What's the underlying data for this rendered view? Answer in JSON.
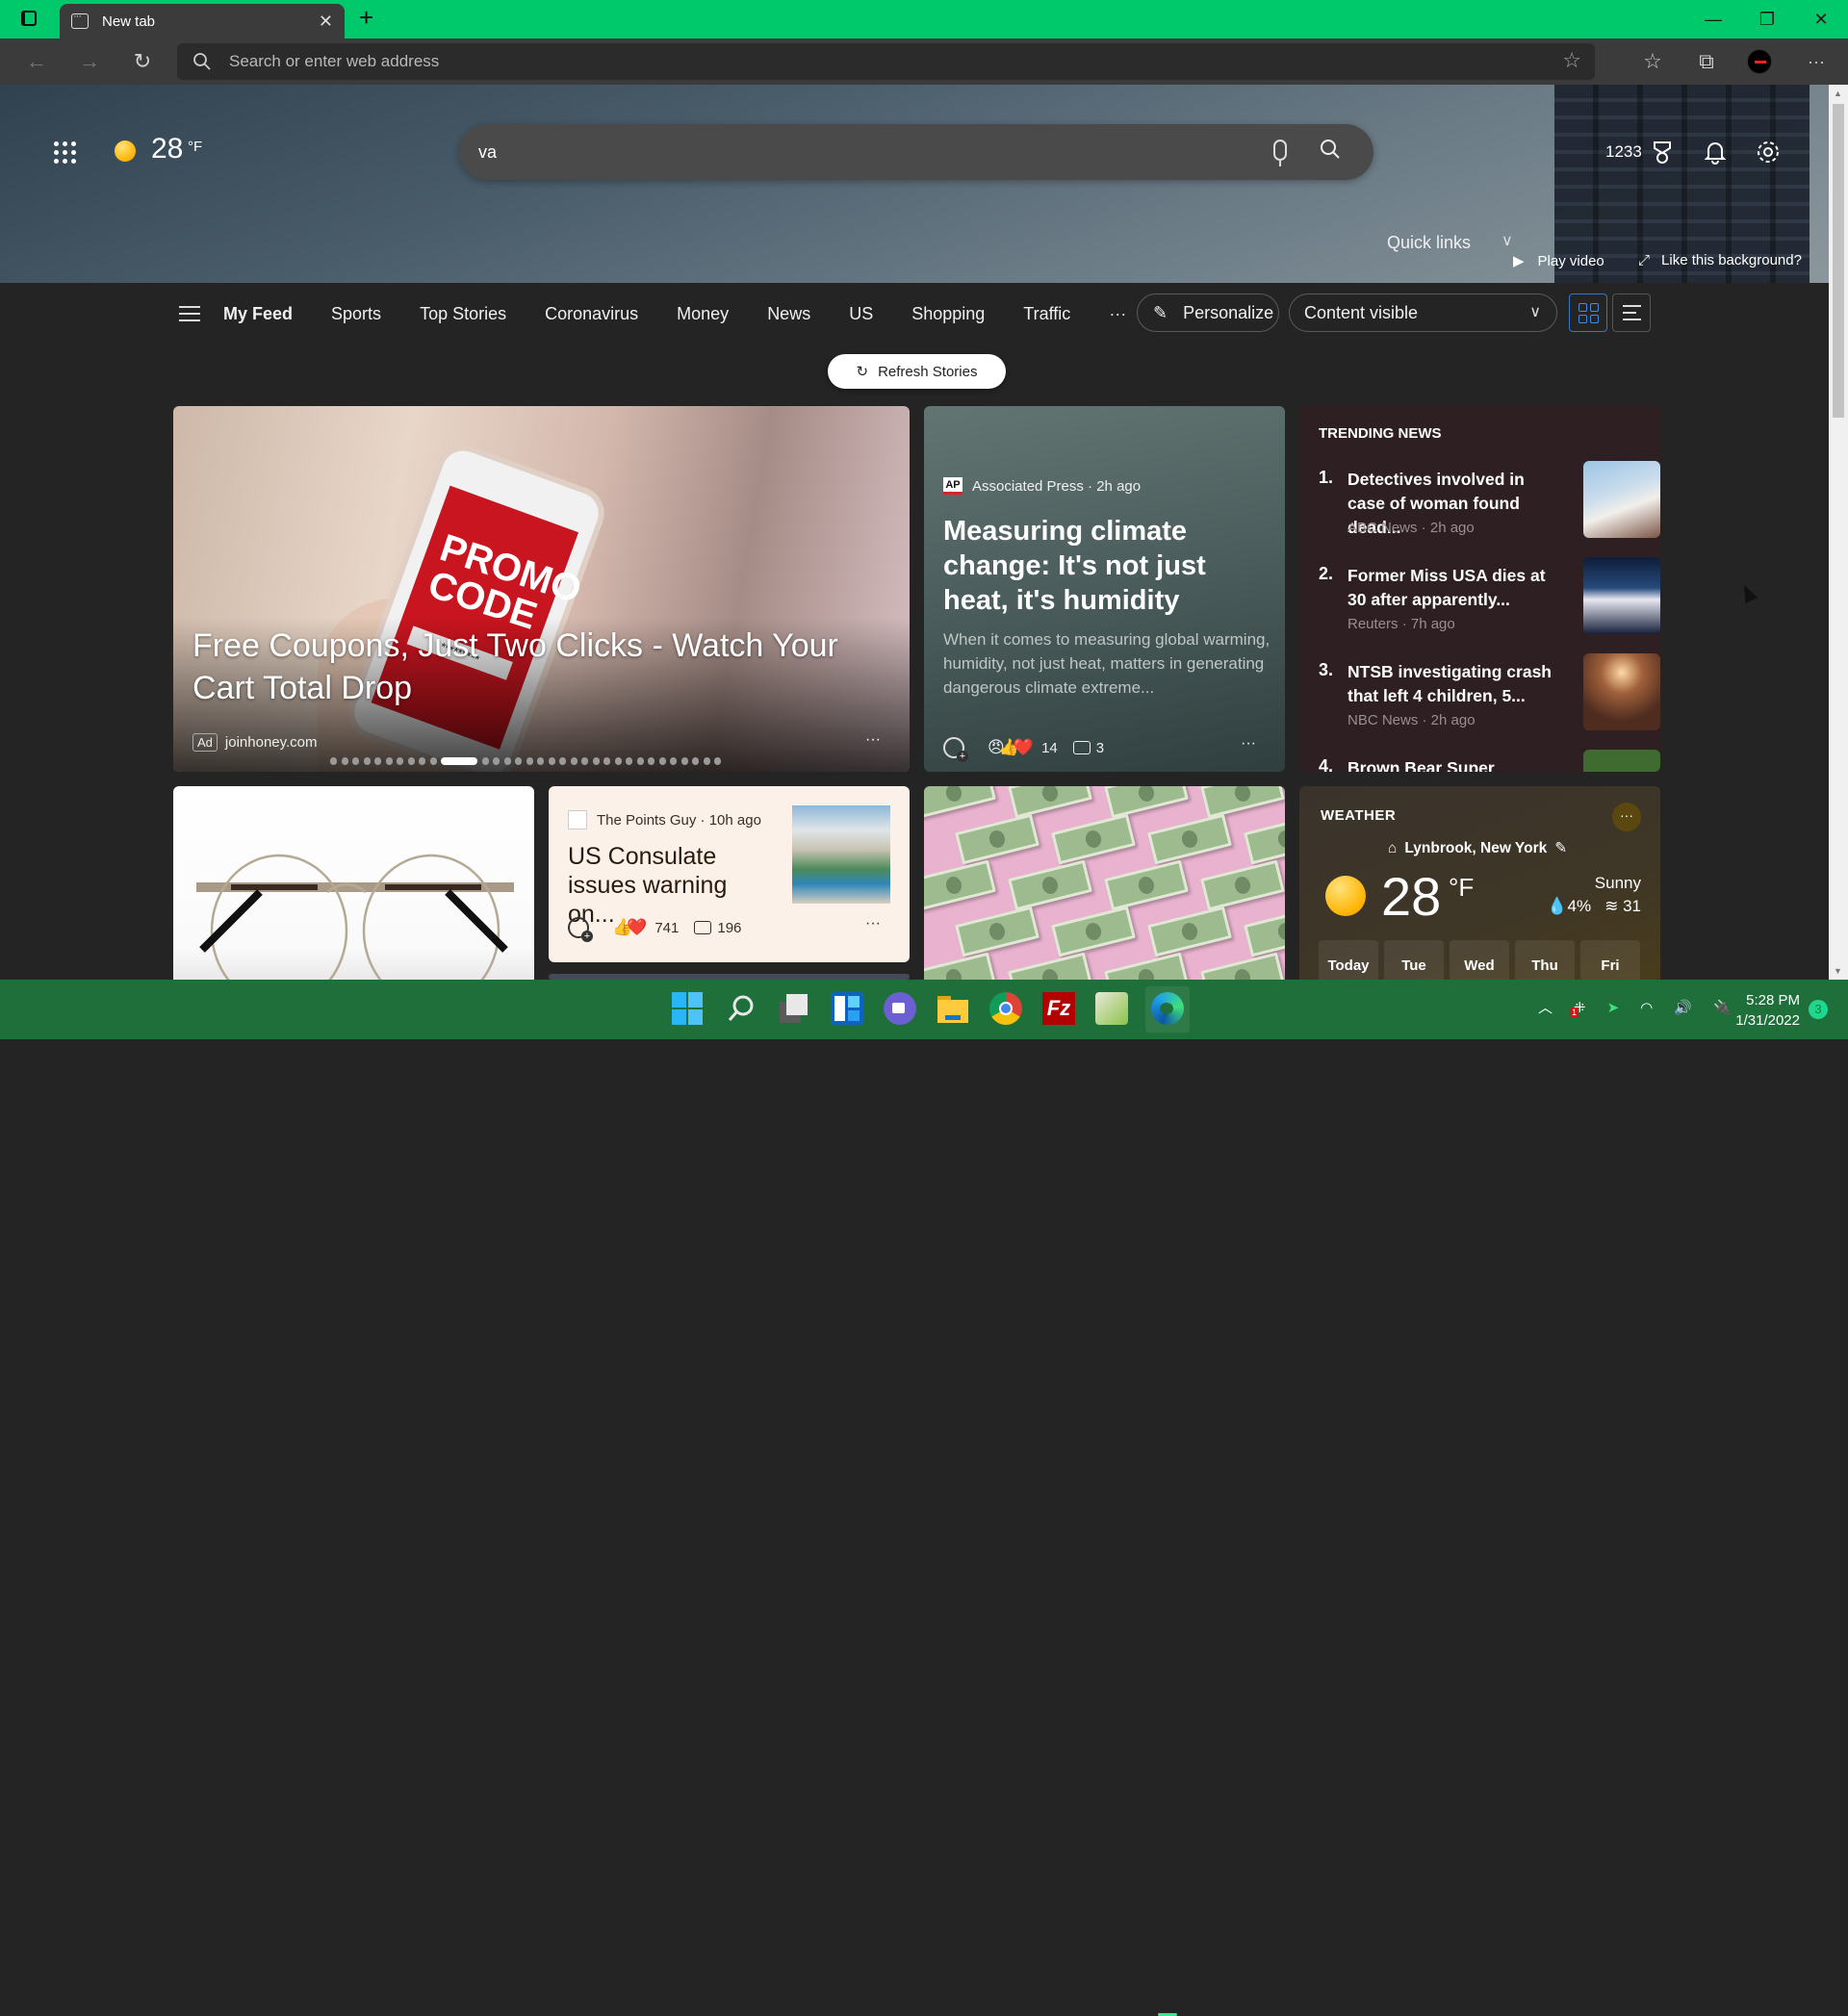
{
  "browser": {
    "tab_title": "New tab",
    "address_placeholder": "Search or enter web address",
    "accent_color": "#00c96b"
  },
  "banner": {
    "temperature": "28",
    "temperature_unit": "°F",
    "search_value": "va",
    "rewards_points": "1233",
    "quick_links_label": "Quick links",
    "play_video_label": "Play video",
    "like_background_label": "Like this background?"
  },
  "nav": {
    "items": [
      {
        "label": "My Feed",
        "active": true
      },
      {
        "label": "Sports"
      },
      {
        "label": "Top Stories"
      },
      {
        "label": "Coronavirus"
      },
      {
        "label": "Money"
      },
      {
        "label": "News"
      },
      {
        "label": "US"
      },
      {
        "label": "Shopping"
      },
      {
        "label": "Traffic"
      }
    ],
    "more_label": "···",
    "personalize_label": "Personalize",
    "content_visibility": "Content visible",
    "refresh_label": "Refresh Stories"
  },
  "hero": {
    "title": "Free Coupons, Just Two Clicks - Watch Your Cart Total Drop",
    "ad_tag": "Ad",
    "source": "joinhoney.com",
    "phone_text": "PROMO CODE",
    "carousel": {
      "total": 33,
      "active_index": 10
    }
  },
  "ap_card": {
    "source": "Associated Press · 2h ago",
    "logo": "AP",
    "title": "Measuring climate change: It's not just heat, it's humidity",
    "description": "When it comes to measuring global warming, humidity, not just heat, matters in generating dangerous climate extreme...",
    "reactions": "😠👍❤️",
    "reaction_count": "14",
    "comment_count": "3"
  },
  "trending": {
    "heading": "TRENDING NEWS",
    "items": [
      {
        "num": "1.",
        "title": "Detectives involved in case of woman found dead...",
        "source": "ABC News · 2h ago"
      },
      {
        "num": "2.",
        "title": "Former Miss USA dies at 30 after apparently...",
        "source": "Reuters · 7h ago"
      },
      {
        "num": "3.",
        "title": "NTSB investigating crash that left 4 children, 5...",
        "source": "NBC News · 2h ago"
      },
      {
        "num": "4.",
        "title": "Brown Bear Super",
        "source": ""
      }
    ]
  },
  "tpg_card": {
    "source": "The Points Guy · 10h ago",
    "title": "US Consulate issues warning on...",
    "reactions": "👍❤️",
    "reaction_count": "741",
    "comment_count": "196"
  },
  "weather": {
    "heading": "WEATHER",
    "location": "Lynbrook, New York",
    "temperature": "28",
    "unit": "°F",
    "condition": "Sunny",
    "precipitation": "4%",
    "wind": "31",
    "days": [
      "Today",
      "Tue",
      "Wed",
      "Thu",
      "Fri"
    ]
  },
  "taskbar": {
    "time": "5:28 PM",
    "date": "1/31/2022",
    "notification_count": "3",
    "dropbox_badge": "1",
    "apps": [
      "start",
      "search",
      "task-view",
      "widgets",
      "teams-chat",
      "file-explorer",
      "chrome",
      "filezilla",
      "notepad-plus-plus",
      "edge"
    ]
  }
}
